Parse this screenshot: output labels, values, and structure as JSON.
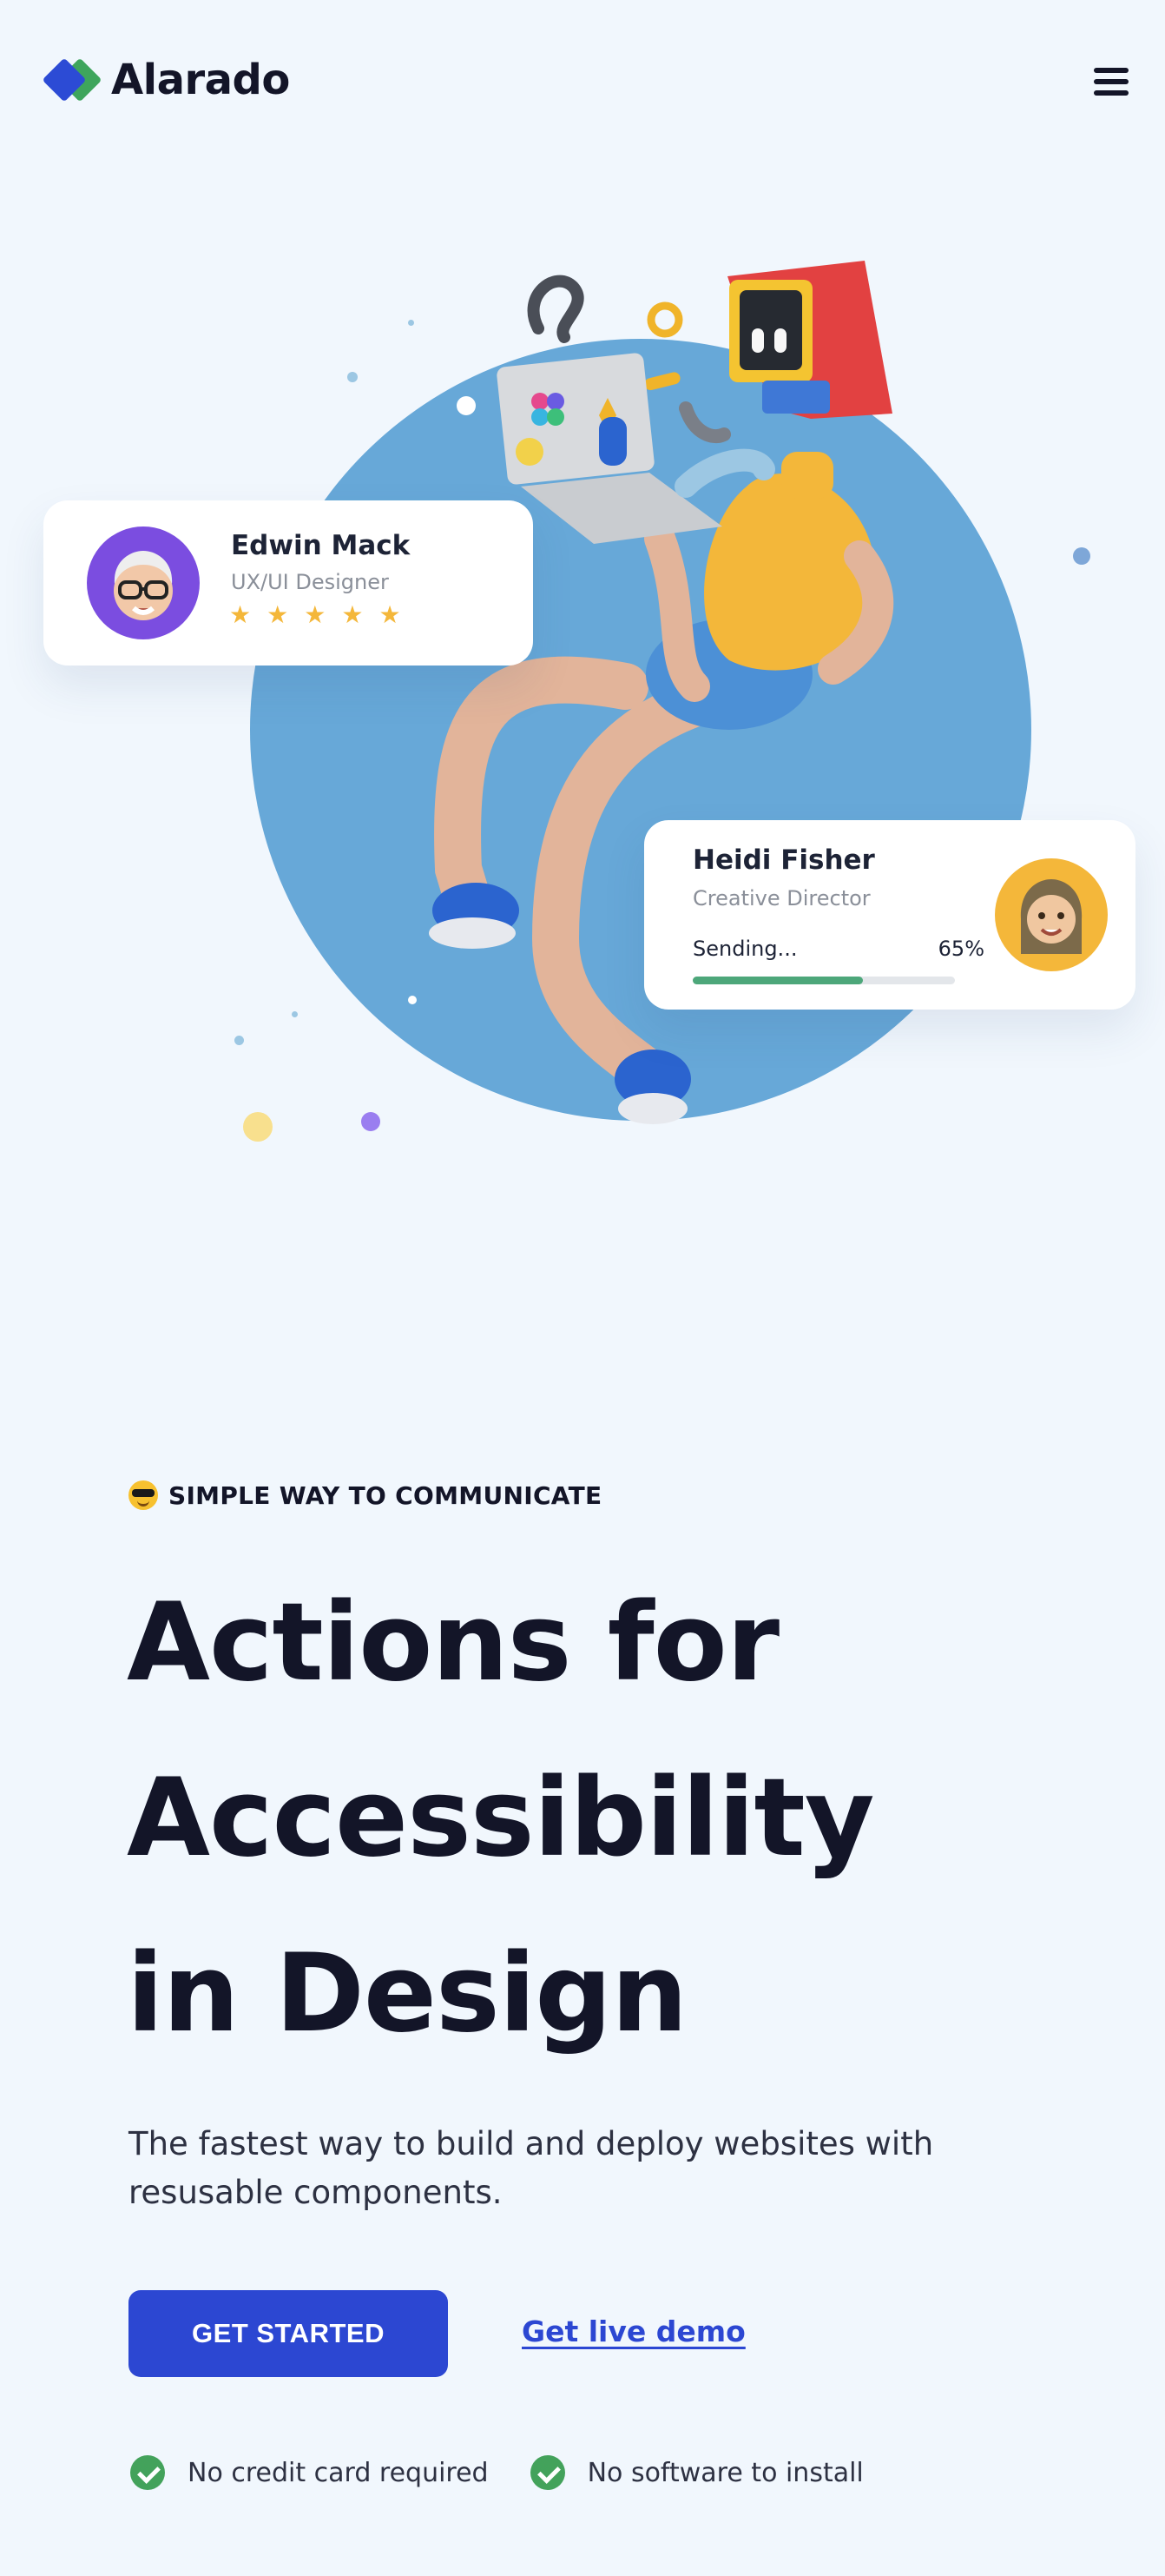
{
  "brand": {
    "name": "Alarado"
  },
  "header": {
    "menu_icon": "hamburger-menu-icon"
  },
  "hero": {
    "illustration_icon": "3d-character-illustration",
    "cards": {
      "edwin": {
        "name": "Edwin Mack",
        "role": "UX/UI Designer",
        "rating": 5,
        "stars": [
          "★",
          "★",
          "★",
          "★",
          "★"
        ],
        "avatar_icon": "memoji-avatar-icon"
      },
      "heidi": {
        "name": "Heidi Fisher",
        "role": "Creative Director",
        "status_label": "Sending...",
        "progress_text": "65%",
        "progress": 0.65,
        "avatar_icon": "memoji-avatar-icon"
      }
    }
  },
  "content": {
    "eyebrow": "SIMPLE WAY TO COMMUNICATE",
    "eyebrow_icon": "sunglasses-emoji-icon",
    "headline": [
      "Actions for",
      "Accessibility",
      "in Design"
    ],
    "subtext": "The fastest way to build and deploy websites with resusable components.",
    "cta_primary": "GET STARTED",
    "cta_secondary": "Get live demo",
    "features": [
      "No credit card required",
      "No software to install"
    ],
    "feature_icon": "check-circle-icon"
  },
  "colors": {
    "background": "#f1f7fd",
    "accent": "#2c47d2",
    "brand_blue": "#2c4bd5",
    "brand_green": "#3ea55c",
    "circle": "#67a8d8",
    "star": "#f4b73a",
    "progress": "#4da77a",
    "check": "#43a25b"
  }
}
